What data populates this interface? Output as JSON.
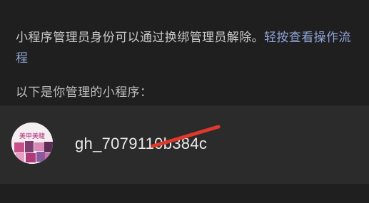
{
  "intro": {
    "text": "小程序管理员身份可以通过换绑管理员解除。",
    "link": "轻按查看操作流程"
  },
  "section_label": "以下是你管理的小程序：",
  "mini_program": {
    "app_id": "gh_7079110b384c",
    "avatar_text": "美甲美睫"
  },
  "colors": {
    "background": "#1f1f1f",
    "row_background": "#2b2b2b",
    "link": "#8fa4d8",
    "scribble": "#e0382b"
  }
}
